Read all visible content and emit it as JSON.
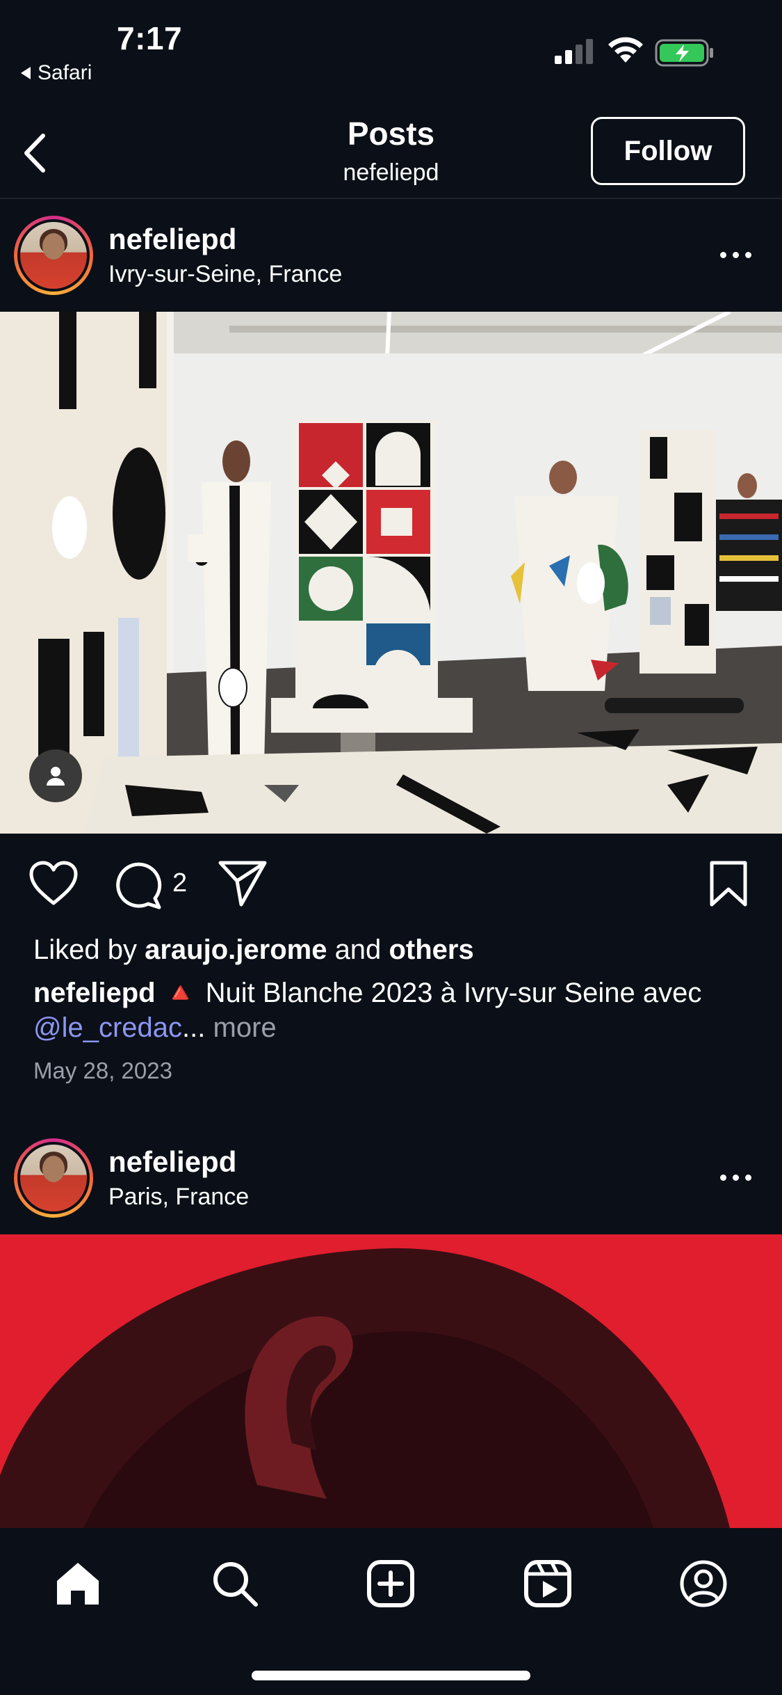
{
  "status_bar": {
    "time": "7:17",
    "back_app": "Safari"
  },
  "header": {
    "title": "Posts",
    "subtitle": "nefeliepd",
    "follow_label": "Follow"
  },
  "posts": [
    {
      "username": "nefeliepd",
      "location": "Ivry-sur-Seine, France",
      "comment_count": "2",
      "liked_prefix": "Liked by",
      "liked_user": "araujo.jerome",
      "liked_and": "and",
      "liked_others": "others",
      "caption_user": "nefeliepd",
      "caption_emoji": "🔺",
      "caption_text": "Nuit Blanche 2023 à Ivry-sur Seine avec",
      "caption_mention": "@le_credac",
      "caption_ellipsis": "...",
      "caption_more": "more",
      "date": "May 28, 2023"
    },
    {
      "username": "nefeliepd",
      "location": "Paris, France"
    }
  ],
  "tab_bar": {
    "items": [
      "home-icon",
      "search-icon",
      "create-icon",
      "reels-icon",
      "profile-icon"
    ]
  },
  "colors": {
    "background": "#0b0f17",
    "mention": "#8c96f2",
    "muted": "#9aa0aa",
    "battery": "#34c759"
  }
}
